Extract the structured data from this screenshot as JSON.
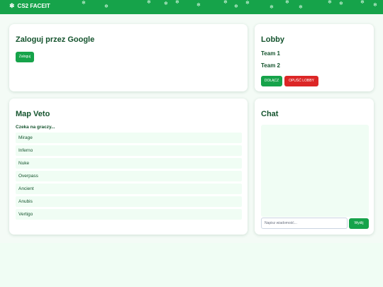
{
  "header": {
    "brand_icon": "snowflake-icon",
    "title": "CS2 FACEIT",
    "decoration_glyph": "❄"
  },
  "login": {
    "title": "Zaloguj przez Google",
    "button_label": "Zaloguj"
  },
  "lobby": {
    "title": "Lobby",
    "team1": "Team 1",
    "team2": "Team 2",
    "join_label": "DOŁĄCZ",
    "leave_label": "OPUŚĆ LOBBY"
  },
  "map_veto": {
    "title": "Map Veto",
    "status": "Czeka na graczy...",
    "maps": [
      "Mirage",
      "Inferno",
      "Nuke",
      "Overpass",
      "Ancient",
      "Anubis",
      "Vertigo"
    ]
  },
  "chat": {
    "title": "Chat",
    "input_placeholder": "Napisz wiadomość...",
    "send_label": "Wyślij"
  },
  "colors": {
    "accent": "#16a34a",
    "danger": "#dc2626",
    "text": "#14532d",
    "background": "#f0fdf4"
  }
}
